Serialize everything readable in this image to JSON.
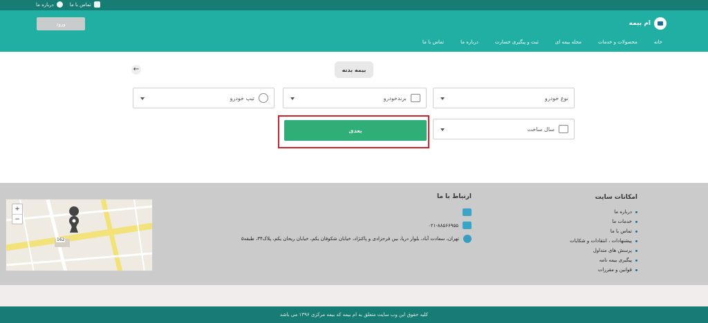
{
  "topbar": {
    "links": [
      {
        "label": "درباره ما",
        "icon": "info-icon"
      },
      {
        "label": "تماس با ما",
        "icon": "mail-icon"
      }
    ]
  },
  "header": {
    "brand": "ام بیمه",
    "login_label": "ورود",
    "nav": [
      "خانه",
      "محصولات و خدمات",
      "مجله بیمه ای",
      "ثبت و پیگیری خسارت",
      "درباره ما",
      "تماس با ما"
    ]
  },
  "main": {
    "page_chip": "بیمه بدنه",
    "fields": {
      "car_type": "نوع خودرو",
      "car_brand": "برندخودرو",
      "car_model": "تیپ خودرو",
      "build_year": "سال ساخت"
    },
    "next_label": "بعدی"
  },
  "footer": {
    "features_title": "امکانات سایت",
    "features": [
      "درباره ما",
      "خدمات ما",
      "تماس با ما",
      "پیشنهادات ، انتقادات و شکایات",
      "پرسش های متداول",
      "پیگیری بیمه نامه",
      "قوانین و مقررات"
    ],
    "contact_title": "ارتباط با ما",
    "phone": "۰۲۱-۸۸۵۶۶۹۵۵",
    "address": "تهران، سعادت آباد، بلوار دریا، بین فرحزادی و پاکنژاد، خیابان شکوفان یکم، خیابان ریحان یکم، پلاک۳۴، طبقه۵",
    "map_zoom_in": "+",
    "map_zoom_out": "−",
    "map_label": "162",
    "copyright": "کلیه حقوق این وب سایت متعلق به ام بیمه کد بیمه مرکزی ۱۳۹۶ می باشد"
  },
  "colors": {
    "header": "#21afa4",
    "topbar": "#167c74",
    "next_button": "#2fae77",
    "highlight": "#d1202a",
    "footer": "#cbcbcb"
  }
}
